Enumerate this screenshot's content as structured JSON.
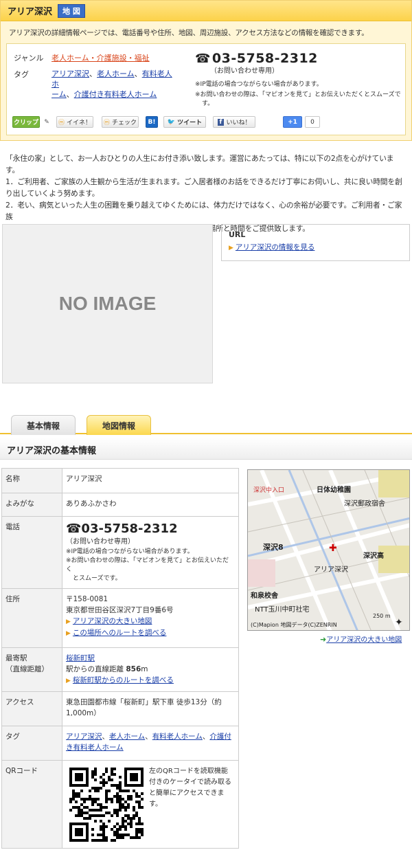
{
  "header": {
    "title": "アリア深沢",
    "map_badge": "地 図",
    "description": "アリア深沢の詳細情報ページでは、電話番号や住所、地図、周辺施設、アクセス方法などの情報を確認できます。"
  },
  "info": {
    "genre_label": "ジャンル",
    "genre_value": "老人ホーム・介護施設・福祉",
    "tag_label": "タグ",
    "tags_line1": [
      "アリア深沢",
      "老人ホーム",
      "有料老人ホ"
    ],
    "tags_line2": [
      "ーム",
      "介護付き有料老人ホーム"
    ],
    "phone": "03-5758-2312",
    "phone_note": "（お問い合わせ専用）",
    "note1": "※IP電話の場合つながらない場合があります。",
    "note2a": "※お問い合わせの際は、「マピオンを見て」とお伝えいただくとスムーズで",
    "note2b": "す。"
  },
  "social": {
    "clip": "クリップ",
    "iine": "イイネ！",
    "check": "チェック",
    "b": "B!",
    "tweet": "ツイート",
    "like": "いいね！",
    "plus": "+1",
    "plus_count": "0"
  },
  "intro": {
    "lines": [
      "「永住の家」として、お一人おひとりの人生にお付き添い致します。運営にあたっては、特に以下の2点を心がけています。",
      "1．ご利用者、ご家族の人生観から生活が生まれます。ご入居者様のお話をできるだけ丁寧にお伺いし、共に良い時間を創",
      "り出していくよう努めます。",
      "2．老い、病気といった人生の困難を乗り越えてゆくためには、体力だけではなく、心の余裕が必要です。ご利用者・ご家族",
      "に、より気持ちの余裕を持っていただけるよう、心が開かれる場所と時間をご提供致します。"
    ]
  },
  "noimage": "NO IMAGE",
  "url": {
    "heading": "URL",
    "link": "アリア深沢の情報を見る"
  },
  "tabs": {
    "basic": "基本情報",
    "map": "地図情報"
  },
  "section_title": "アリア深沢の基本情報",
  "table": {
    "name_l": "名称",
    "name_v": "アリア深沢",
    "kana_l": "よみがな",
    "kana_v": "ありあふかさわ",
    "tel_l": "電話",
    "tel_v": "03-5758-2312",
    "tel_note": "（お問い合わせ専用）",
    "tel_n1": "※IP電話の場合つながらない場合があります。",
    "tel_n2a": "※お問い合わせの際は、「マピオンを見て」とお伝えいただく",
    "tel_n2b": "とスムーズです。",
    "addr_l": "住所",
    "zip": "〒158-0081",
    "addr": "東京都世田谷区深沢7丁目9番6号",
    "addr_link1": "アリア深沢の大きい地図",
    "addr_link2": "この場所へのルートを調べる",
    "station_l1": "最寄駅",
    "station_l2": "（直線距離）",
    "station": "桜新町駅",
    "dist_prefix": "駅からの直線距離 ",
    "dist_value": "856",
    "dist_unit": "m",
    "station_link": "桜新町駅からのルートを調べる",
    "access_l": "アクセス",
    "access_v": "東急田園都市線「桜新町」駅下車 徒歩13分（約1,000m）",
    "tag_l": "タグ",
    "tags": [
      "アリア深沢",
      "老人ホーム",
      "有料老人ホーム",
      "介護付き有料老人ホーム"
    ],
    "qr_l": "QRコード",
    "qr_text": "左のQRコードを読取機能付きのケータイで読み取ると簡単にアクセスできます。"
  },
  "map": {
    "labels": [
      "深沢中入口",
      "日体幼稚園",
      "深沢郵政宿舎",
      "深沢8",
      "深沢高",
      "アリア深沢",
      "和泉校舎",
      "NTT玉川中町社宅"
    ],
    "credit": "(C)Mapion 地図データ(C)ZENRIN",
    "scale": "250 m",
    "link": "アリア深沢の大きい地図"
  }
}
